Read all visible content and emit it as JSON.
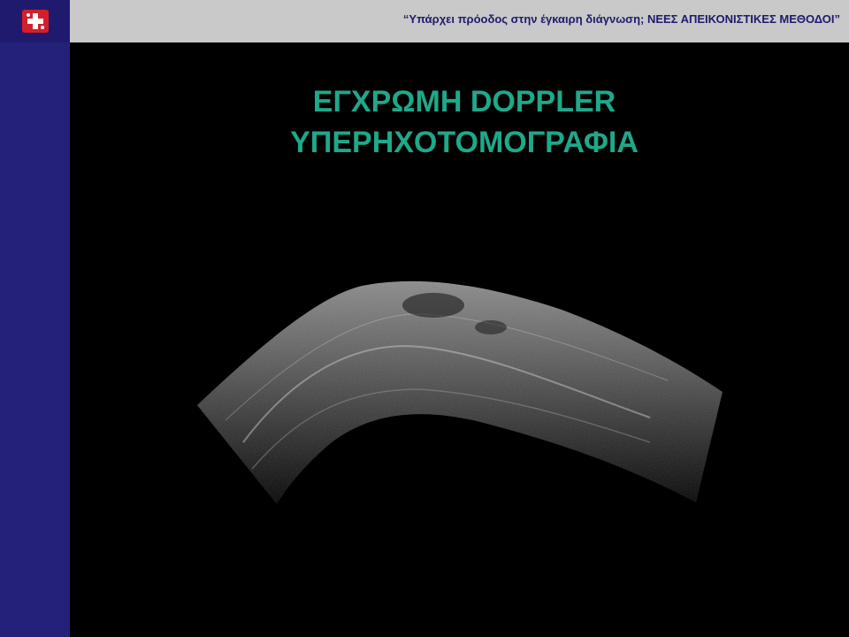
{
  "header": {
    "text": "“Υπάρχει πρόοδος στην έγκαιρη διάγνωση;  ΝΕΕΣ ΑΠΕΙΚΟΝΙΣΤΙΚΕΣ  ΜΕΘΟΔΟΙ”",
    "logo_icon": "medical-cross-logo-icon"
  },
  "title": {
    "line1": "ΕΓΧΡΩΜΗ DOPPLER",
    "line2": "ΥΠΕΡΗΧΟΤΟΜΟΓΡΑΦΙΑ"
  },
  "colors": {
    "header_bg": "#c9c9c9",
    "sidebar_bg": "#24217a",
    "title_color": "#1fa88a",
    "header_text": "#1f1a6e"
  }
}
